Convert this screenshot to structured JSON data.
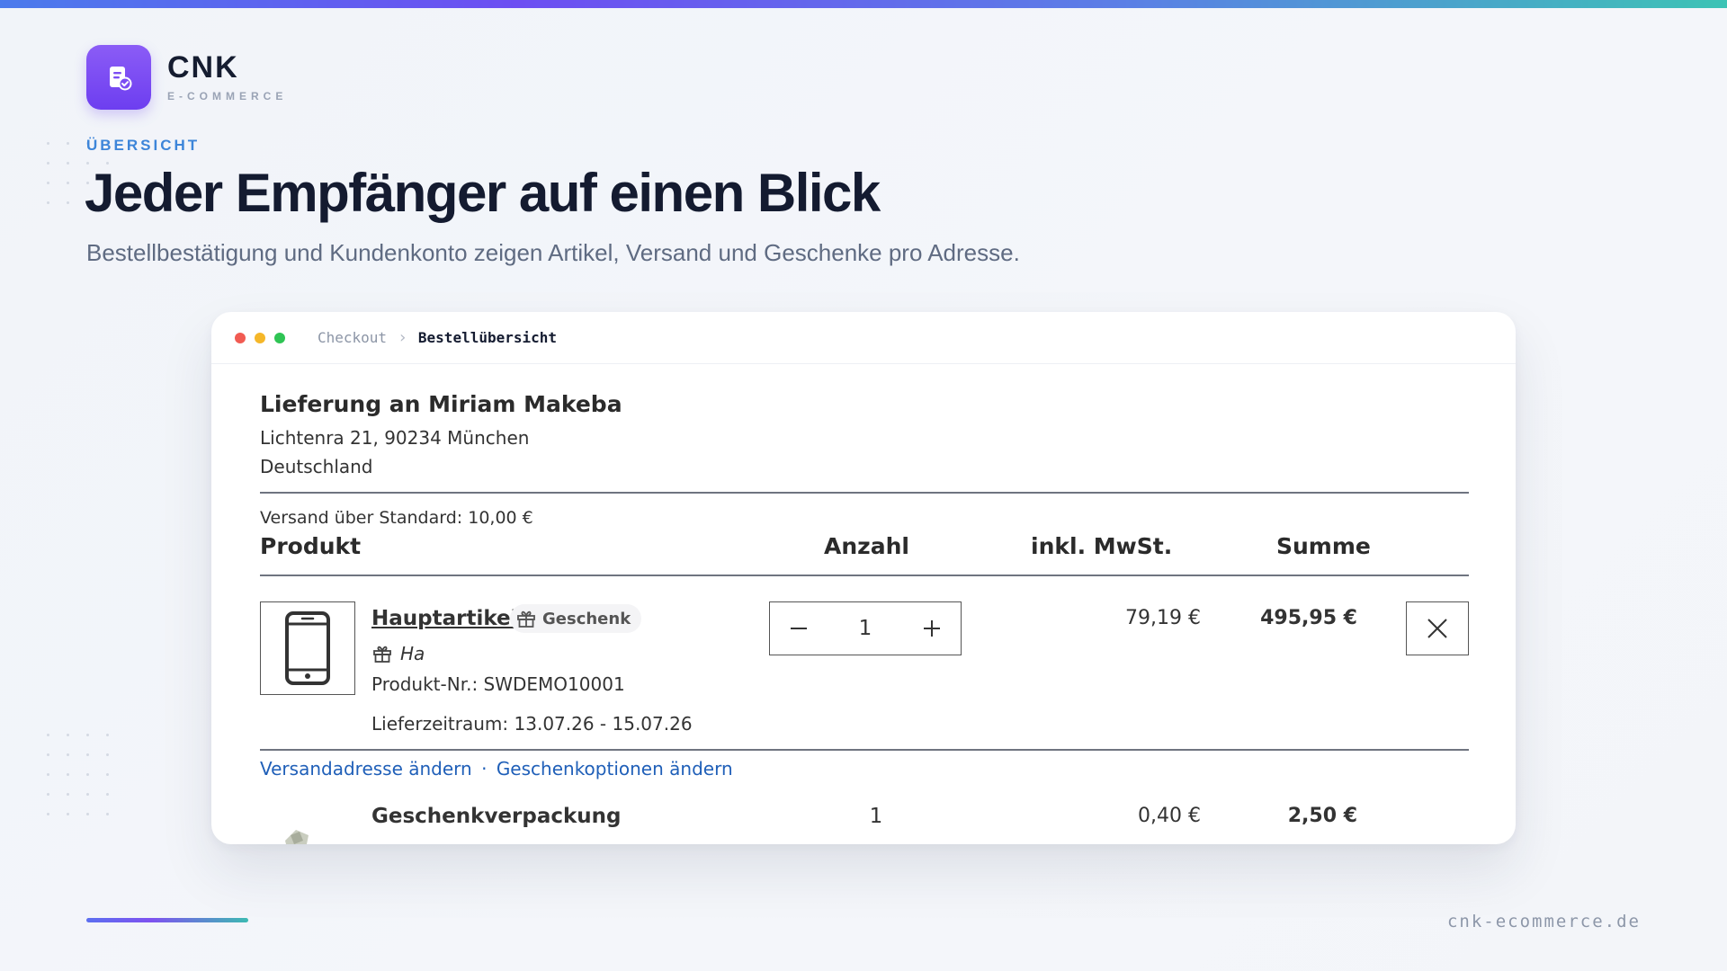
{
  "brand": {
    "name": "CNK",
    "sub": "E-COMMERCE"
  },
  "eyebrow": "ÜBERSICHT",
  "headline": "Jeder Empfänger auf einen Blick",
  "subhead": "Bestellbestätigung und Kundenkonto zeigen Artikel, Versand und Geschenke pro Adresse.",
  "window": {
    "breadcrumb": [
      "Checkout",
      "Bestellübersicht"
    ],
    "shipment": {
      "title": "Lieferung an Miriam Makeba",
      "address_line1": "Lichtenra 21, 90234 München",
      "address_line2": "Deutschland",
      "shipping_method": "Versand über Standard: 10,00 €"
    },
    "table": {
      "headers": {
        "product": "Produkt",
        "quantity": "Anzahl",
        "tax": "inkl. MwSt.",
        "sum": "Summe"
      }
    },
    "item": {
      "name": "Hauptartikel",
      "gift_badge": "Geschenk",
      "gift_text": "Ha",
      "product_number": "Produkt-Nr.: SWDEMO10001",
      "delivery": "Lieferzeitraum: 13.07.26 - 15.07.26",
      "quantity": "1",
      "tax": "79,19 €",
      "sum": "495,95 €"
    },
    "links": {
      "change_address": "Versandadresse ändern",
      "separator": "·",
      "change_gift": "Geschenkoptionen ändern"
    },
    "item2": {
      "name": "Geschenkverpackung",
      "quantity": "1",
      "tax": "0,40 €",
      "sum": "2,50 €"
    }
  },
  "footer": {
    "url": "cnk-ecommerce.de"
  },
  "colors": {
    "accent": "#6d3ef0",
    "eyebrow": "#3d85d9",
    "link": "#1f5fb8"
  }
}
